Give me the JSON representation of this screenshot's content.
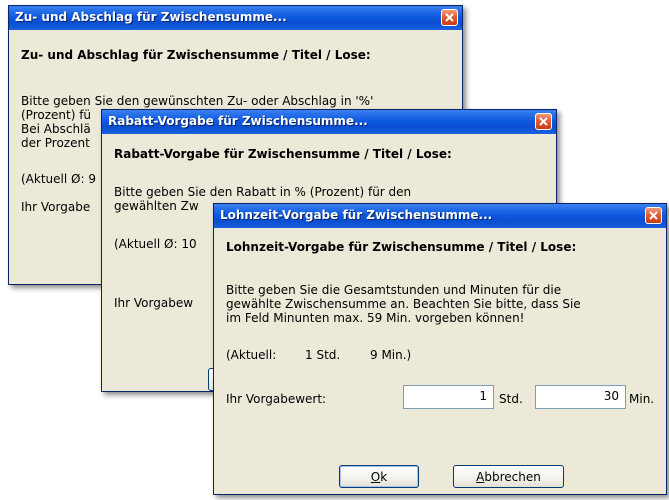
{
  "dialog1": {
    "title": "Zu- und Abschlag für Zwischensumme...",
    "heading": "Zu- und Abschlag für Zwischensumme / Titel / Lose:",
    "line1": "Bitte geben Sie den gewünschten Zu- oder Abschlag in '%'",
    "line2": "(Prozent) fü",
    "line3": "Bei Abschlä",
    "line4": "der Prozent",
    "current": "(Aktuell Ø: 9",
    "input_label": "Ihr Vorgabe"
  },
  "dialog2": {
    "title": "Rabatt-Vorgabe für Zwischensumme...",
    "heading": "Rabatt-Vorgabe für Zwischensumme / Titel / Lose:",
    "line1": "Bitte geben Sie den Rabatt in % (Prozent) für den",
    "line2": "gewählten Zw",
    "current": "(Aktuell Ø: 10",
    "input_label": "Ihr Vorgabew"
  },
  "dialog3": {
    "title": "Lohnzeit-Vorgabe für Zwischensumme...",
    "heading": "Lohnzeit-Vorgabe für Zwischensumme / Titel / Lose:",
    "line1": "Bitte geben Sie die Gesamtstunden und Minuten für die",
    "line2": "gewählte Zwischensumme an. Beachten Sie bitte, dass Sie",
    "line3": "im Feld Minunten max. 59 Min. vorgeben können!",
    "current_label": "(Aktuell:",
    "current_hours": "1 Std.",
    "current_minutes": "9 Min.)",
    "input_label": "Ihr Vorgabewert:",
    "hours_value": "1",
    "hours_unit": "Std.",
    "minutes_value": "30",
    "minutes_unit": "Min.",
    "ok_prefix": "",
    "ok_underlined": "O",
    "ok_suffix": "k",
    "cancel_underlined": "A",
    "cancel_suffix": "bbrechen"
  },
  "colors": {
    "title_bar": "#0a4fd0",
    "dialog_bg": "#ece9d8",
    "close_button": "#e0592e"
  }
}
